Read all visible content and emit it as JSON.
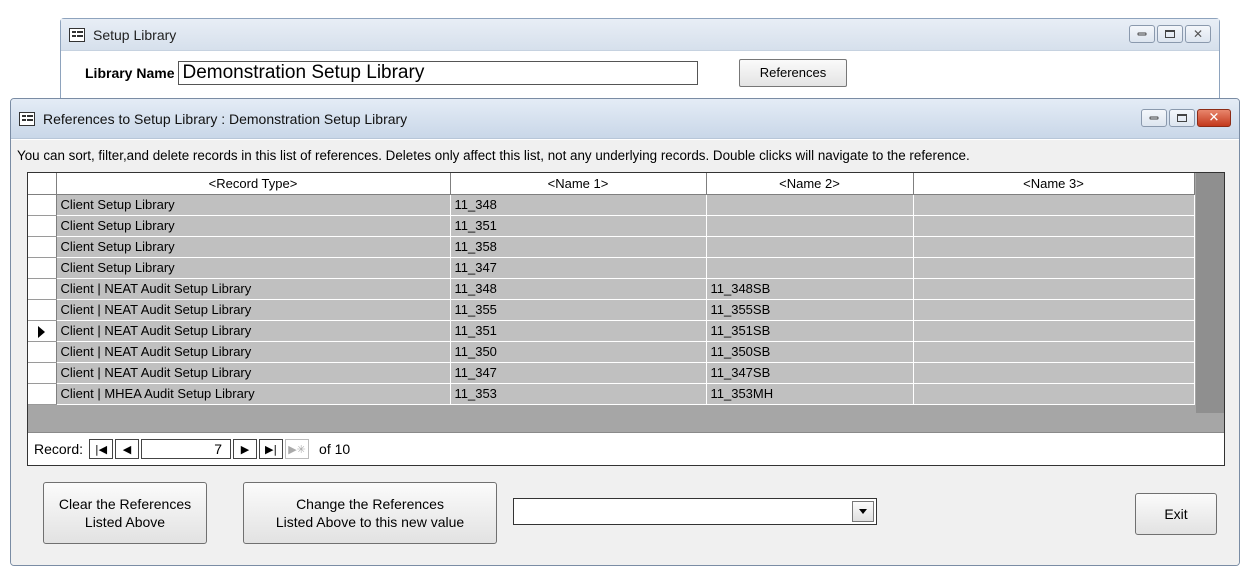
{
  "setup_library_window": {
    "title": "Setup Library",
    "library_name_label": "Library Name",
    "library_name_value": "Demonstration Setup Library",
    "references_button": "References"
  },
  "references_window": {
    "title": "References to Setup Library : Demonstration Setup Library",
    "instructions": "You can sort, filter,and delete records in this list of references.  Deletes only affect this list, not any underlying records.  Double clicks will navigate to the reference.",
    "columns": [
      "<Record Type>",
      "<Name 1>",
      "<Name 2>",
      "<Name 3>"
    ],
    "rows": [
      {
        "record_type": "Client Setup Library",
        "name1": "11_348",
        "name2": "",
        "name3": ""
      },
      {
        "record_type": "Client Setup Library",
        "name1": "11_351",
        "name2": "",
        "name3": ""
      },
      {
        "record_type": "Client Setup Library",
        "name1": "11_358",
        "name2": "",
        "name3": ""
      },
      {
        "record_type": "Client Setup Library",
        "name1": "11_347",
        "name2": "",
        "name3": ""
      },
      {
        "record_type": "Client | NEAT Audit Setup Library",
        "name1": "11_348",
        "name2": "11_348SB",
        "name3": ""
      },
      {
        "record_type": "Client | NEAT Audit Setup Library",
        "name1": "11_355",
        "name2": "11_355SB",
        "name3": ""
      },
      {
        "record_type": "Client | NEAT Audit Setup Library",
        "name1": "11_351",
        "name2": "11_351SB",
        "name3": ""
      },
      {
        "record_type": "Client | NEAT Audit Setup Library",
        "name1": "11_350",
        "name2": "11_350SB",
        "name3": ""
      },
      {
        "record_type": "Client | NEAT Audit Setup Library",
        "name1": "11_347",
        "name2": "11_347SB",
        "name3": ""
      },
      {
        "record_type": "Client | MHEA Audit Setup Library",
        "name1": "11_353",
        "name2": "11_353MH",
        "name3": ""
      }
    ],
    "current_row": 7,
    "navigation": {
      "label": "Record:",
      "current": "7",
      "of_text": "of 10"
    },
    "buttons": {
      "clear": "Clear the References Listed Above",
      "change": "Change the References Listed Above to this new value",
      "exit": "Exit"
    },
    "new_value_combo": ""
  }
}
